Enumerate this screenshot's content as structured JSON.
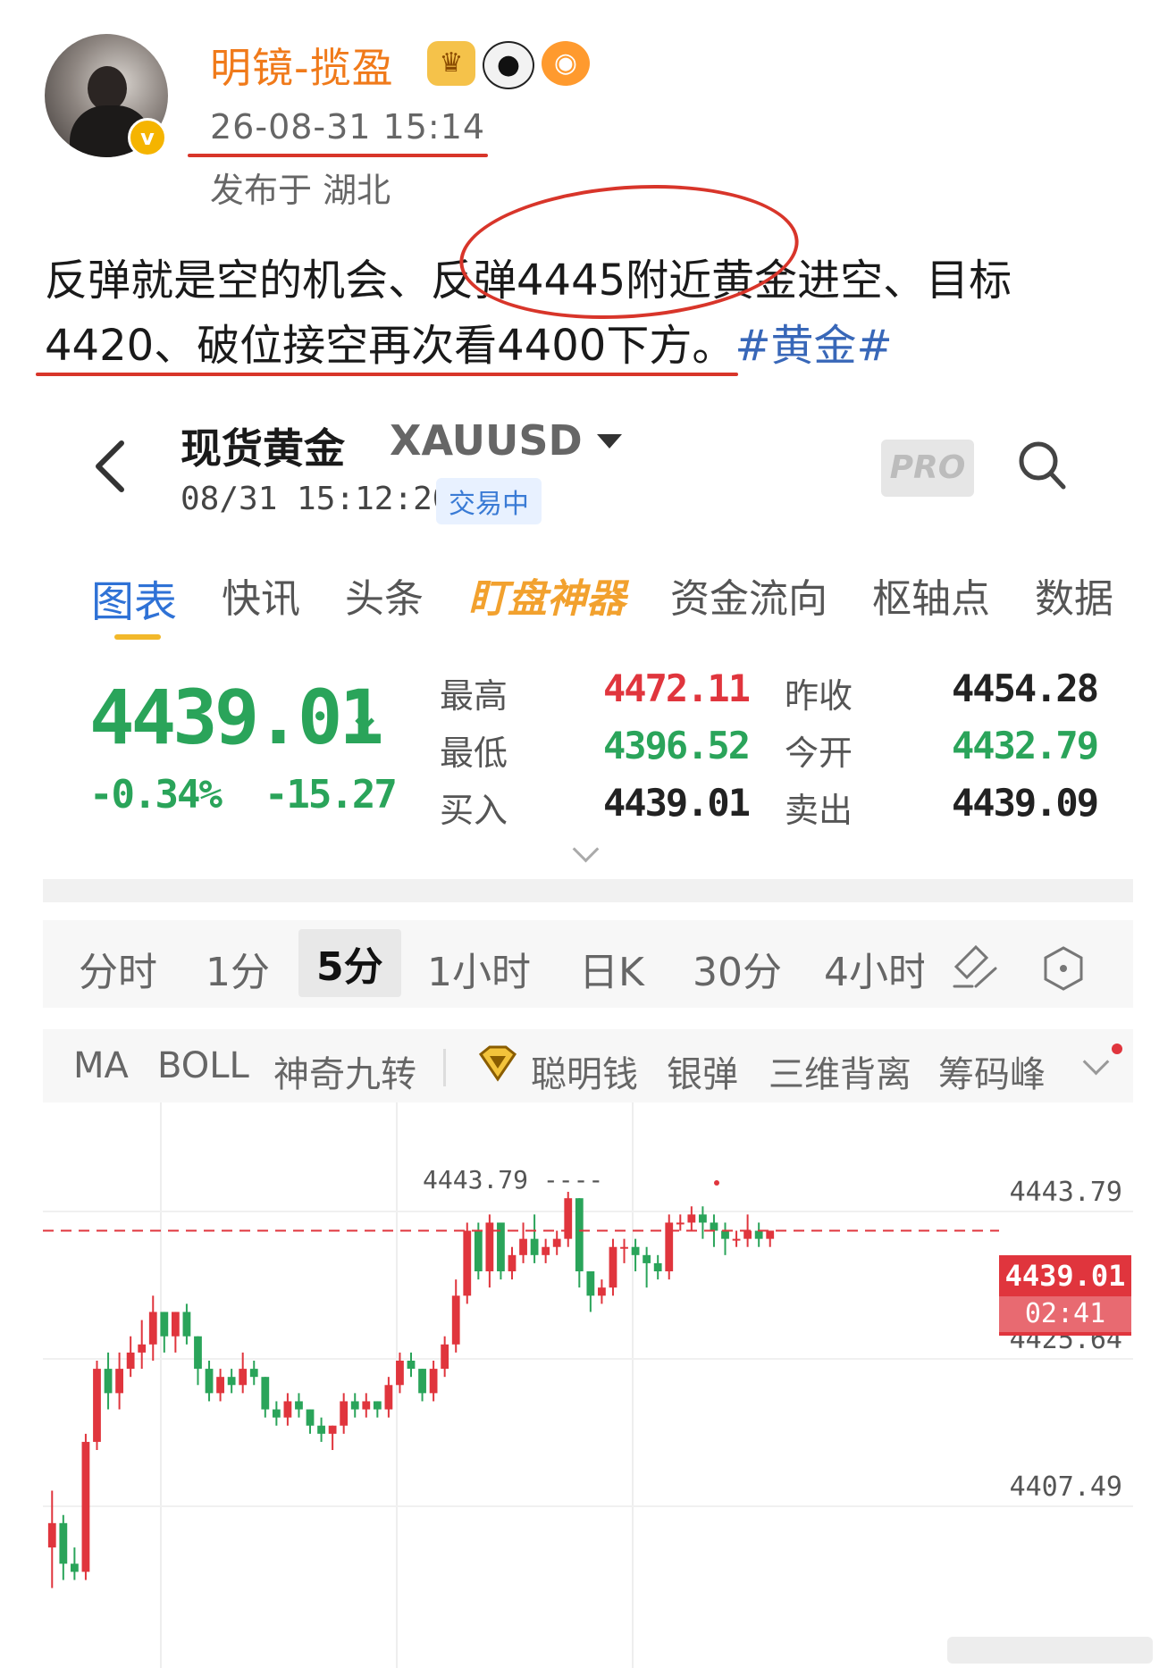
{
  "post": {
    "username": "明镜-揽盈",
    "time": "26-08-31 15:14",
    "location": "发布于 湖北",
    "text": "反弹就是空的机会、反弹4445附近黄金进空、目标4420、破位接空再次看4400下方。",
    "hashtag": "#黄金#"
  },
  "app": {
    "title": "现货黄金",
    "symbol": "XAUUSD",
    "datetime": "08/31 15:12:20",
    "status": "交易中",
    "pro_label": "PRO",
    "tabs": [
      "图表",
      "快讯",
      "头条",
      "盯盘神器",
      "资金流向",
      "枢轴点",
      "数据"
    ]
  },
  "quote": {
    "price": "4439.01",
    "change_pct": "-0.34%",
    "change": "-15.27",
    "high_label": "最高",
    "high": "4472.11",
    "low_label": "最低",
    "low": "4396.52",
    "bid_label": "买入",
    "bid": "4439.01",
    "prev_close_label": "昨收",
    "prev_close": "4454.28",
    "open_label": "今开",
    "open": "4432.79",
    "ask_label": "卖出",
    "ask": "4439.09"
  },
  "periods": [
    "分时",
    "1分",
    "5分",
    "1小时",
    "日K",
    "30分",
    "4小时"
  ],
  "indicators": [
    "MA",
    "BOLL",
    "神奇九转",
    "聪明钱",
    "银弹",
    "三维背离",
    "筹码峰"
  ],
  "chart_data": {
    "type": "candlestick",
    "interval": "5分",
    "y_ticks": [
      "4443.79",
      "4425.64",
      "4407.49"
    ],
    "current_price": "4439.01",
    "countdown": "02:41",
    "high_marker": "4443.79",
    "up_color": "#e0353d",
    "down_color": "#2aa45a",
    "candles": [
      {
        "o": 4400,
        "h": 4407,
        "l": 4395,
        "c": 4403
      },
      {
        "o": 4403,
        "h": 4404,
        "l": 4396,
        "c": 4398
      },
      {
        "o": 4398,
        "h": 4400,
        "l": 4396,
        "c": 4397
      },
      {
        "o": 4397,
        "h": 4414,
        "l": 4396,
        "c": 4413
      },
      {
        "o": 4413,
        "h": 4423,
        "l": 4412,
        "c": 4422
      },
      {
        "o": 4422,
        "h": 4424,
        "l": 4417,
        "c": 4419
      },
      {
        "o": 4419,
        "h": 4424,
        "l": 4417,
        "c": 4422
      },
      {
        "o": 4422,
        "h": 4426,
        "l": 4421,
        "c": 4424
      },
      {
        "o": 4424,
        "h": 4428,
        "l": 4422,
        "c": 4425
      },
      {
        "o": 4425,
        "h": 4431,
        "l": 4423,
        "c": 4429
      },
      {
        "o": 4429,
        "h": 4429,
        "l": 4424,
        "c": 4426
      },
      {
        "o": 4426,
        "h": 4429,
        "l": 4424,
        "c": 4429
      },
      {
        "o": 4429,
        "h": 4430,
        "l": 4425,
        "c": 4426
      },
      {
        "o": 4426,
        "h": 4426,
        "l": 4420,
        "c": 4422
      },
      {
        "o": 4422,
        "h": 4423,
        "l": 4418,
        "c": 4419
      },
      {
        "o": 4419,
        "h": 4422,
        "l": 4418,
        "c": 4421
      },
      {
        "o": 4421,
        "h": 4422,
        "l": 4419,
        "c": 4420
      },
      {
        "o": 4420,
        "h": 4424,
        "l": 4419,
        "c": 4422
      },
      {
        "o": 4422,
        "h": 4423,
        "l": 4420,
        "c": 4421
      },
      {
        "o": 4421,
        "h": 4421,
        "l": 4416,
        "c": 4417
      },
      {
        "o": 4417,
        "h": 4418,
        "l": 4415,
        "c": 4416
      },
      {
        "o": 4416,
        "h": 4419,
        "l": 4415,
        "c": 4418
      },
      {
        "o": 4418,
        "h": 4419,
        "l": 4416,
        "c": 4417
      },
      {
        "o": 4417,
        "h": 4417,
        "l": 4414,
        "c": 4415
      },
      {
        "o": 4415,
        "h": 4416,
        "l": 4413,
        "c": 4414
      },
      {
        "o": 4414,
        "h": 4415,
        "l": 4412,
        "c": 4415
      },
      {
        "o": 4415,
        "h": 4419,
        "l": 4414,
        "c": 4418
      },
      {
        "o": 4418,
        "h": 4419,
        "l": 4416,
        "c": 4417
      },
      {
        "o": 4417,
        "h": 4419,
        "l": 4416,
        "c": 4418
      },
      {
        "o": 4418,
        "h": 4418,
        "l": 4416,
        "c": 4417
      },
      {
        "o": 4417,
        "h": 4421,
        "l": 4416,
        "c": 4420
      },
      {
        "o": 4420,
        "h": 4424,
        "l": 4419,
        "c": 4423
      },
      {
        "o": 4423,
        "h": 4424,
        "l": 4421,
        "c": 4422
      },
      {
        "o": 4422,
        "h": 4422,
        "l": 4418,
        "c": 4419
      },
      {
        "o": 4419,
        "h": 4423,
        "l": 4418,
        "c": 4422
      },
      {
        "o": 4422,
        "h": 4426,
        "l": 4421,
        "c": 4425
      },
      {
        "o": 4425,
        "h": 4433,
        "l": 4424,
        "c": 4431
      },
      {
        "o": 4431,
        "h": 4440,
        "l": 4430,
        "c": 4439
      },
      {
        "o": 4439,
        "h": 4440,
        "l": 4433,
        "c": 4434
      },
      {
        "o": 4434,
        "h": 4441,
        "l": 4432,
        "c": 4440
      },
      {
        "o": 4440,
        "h": 4440,
        "l": 4433,
        "c": 4434
      },
      {
        "o": 4434,
        "h": 4437,
        "l": 4433,
        "c": 4436
      },
      {
        "o": 4436,
        "h": 4440,
        "l": 4435,
        "c": 4438
      },
      {
        "o": 4438,
        "h": 4441,
        "l": 4435,
        "c": 4436
      },
      {
        "o": 4436,
        "h": 4438,
        "l": 4435,
        "c": 4437
      },
      {
        "o": 4437,
        "h": 4439,
        "l": 4436,
        "c": 4438
      },
      {
        "o": 4438,
        "h": 4443.79,
        "l": 4437,
        "c": 4443
      },
      {
        "o": 4443,
        "h": 4443,
        "l": 4432,
        "c": 4434
      },
      {
        "o": 4434,
        "h": 4434,
        "l": 4429,
        "c": 4431
      },
      {
        "o": 4431,
        "h": 4433,
        "l": 4430,
        "c": 4432
      },
      {
        "o": 4432,
        "h": 4438,
        "l": 4431,
        "c": 4437
      },
      {
        "o": 4437,
        "h": 4438,
        "l": 4435,
        "c": 4437
      },
      {
        "o": 4437,
        "h": 4438,
        "l": 4434,
        "c": 4436
      },
      {
        "o": 4436,
        "h": 4437,
        "l": 4432,
        "c": 4435
      },
      {
        "o": 4435,
        "h": 4436,
        "l": 4433,
        "c": 4434
      },
      {
        "o": 4434,
        "h": 4441,
        "l": 4433,
        "c": 4440
      },
      {
        "o": 4440,
        "h": 4441,
        "l": 4439,
        "c": 4440
      },
      {
        "o": 4440,
        "h": 4442,
        "l": 4439,
        "c": 4441
      },
      {
        "o": 4441,
        "h": 4442,
        "l": 4438,
        "c": 4440
      },
      {
        "o": 4440,
        "h": 4441,
        "l": 4437,
        "c": 4439
      },
      {
        "o": 4439,
        "h": 4440,
        "l": 4436,
        "c": 4438
      },
      {
        "o": 4438,
        "h": 4439,
        "l": 4437,
        "c": 4438
      },
      {
        "o": 4438,
        "h": 4441,
        "l": 4437,
        "c": 4439
      },
      {
        "o": 4439,
        "h": 4440,
        "l": 4437,
        "c": 4438
      },
      {
        "o": 4438,
        "h": 4439,
        "l": 4437,
        "c": 4439.01
      }
    ]
  }
}
